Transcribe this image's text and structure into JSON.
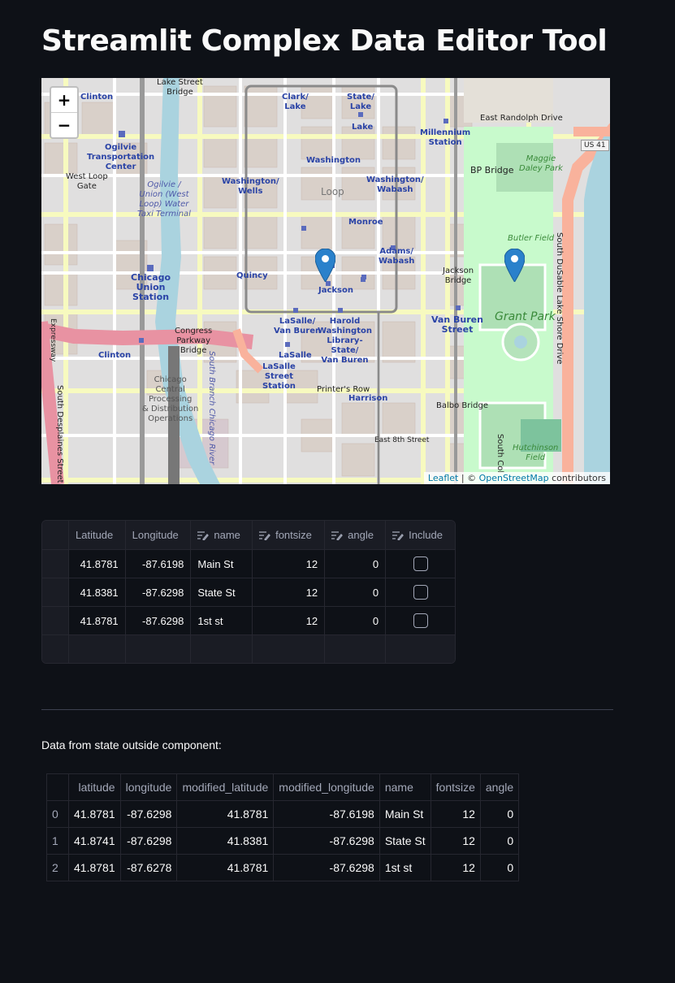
{
  "page": {
    "title": "Streamlit Complex Data Editor Tool"
  },
  "map": {
    "zoom_in": "+",
    "zoom_out": "−",
    "labels": {
      "clinton_top": "Clinton",
      "lake_street_bridge": "Lake Street\nBridge",
      "clark_lake": "Clark/\nLake",
      "state_lake": "State/\nLake",
      "lake": "Lake",
      "east_randolph": "East Randolph Drive",
      "millennium": "Millennium\nStation",
      "us41": "US 41",
      "ogilvie": "Ogilvie\nTransportation\nCenter",
      "west_loop_gate": "West Loop\nGate",
      "ogilvie_taxi": "Ogilvie /\nUnion (West\nLoop) Water\nTaxi Terminal",
      "washington": "Washington",
      "washington_wells": "Washington/\nWells",
      "loop": "Loop",
      "washington_wabash": "Washington/\nWabash",
      "bp_bridge": "BP Bridge",
      "maggie_daley": "Maggie\nDaley Park",
      "monroe": "Monroe",
      "butler_field": "Butler Field",
      "south_dusable": "South DuSable Lake Shore Drive",
      "chicago_union": "Chicago\nUnion\nStation",
      "quincy": "Quincy",
      "jackson": "Jackson",
      "adams_wabash": "Adams/\nWabash",
      "jackson_bridge": "Jackson\nBridge",
      "grant_park": "Grant Park",
      "congress_parkway": "Congress\nParkway\nBridge",
      "lasalle_van_buren": "LaSalle/\nVan Buren",
      "harold_washington": "Harold\nWashington\nLibrary-\nState/\nVan Buren",
      "van_buren_street": "Van Buren\nStreet",
      "clinton_bottom": "Clinton",
      "lasalle": "LaSalle",
      "lasalle_street": "LaSalle\nStreet\nStation",
      "chicago_central": "Chicago\nCentral\nProcessing\n& Distribution\nOperations",
      "south_branch": "South Branch Chicago River",
      "printers_row": "Printer's Row",
      "harrison": "Harrison",
      "balbo_bridge": "Balbo Bridge",
      "east_8th": "East 8th Street",
      "south_desplaines": "South Desplaines Street",
      "south_col": "South Col",
      "hutchinson": "Hutchinson\nField",
      "expressway": "Expressway"
    },
    "attribution": {
      "leaflet": "Leaflet",
      "sep": " | © ",
      "osm": "OpenStreetMap",
      "suffix": " contributors"
    },
    "markers": [
      {
        "label": "Jackson marker",
        "lat": 41.8781,
        "lng": -87.6298
      },
      {
        "label": "Grant Park marker",
        "lat": 41.8781,
        "lng": -87.6198
      }
    ]
  },
  "editor": {
    "columns": [
      "Latitude",
      "Longitude",
      "name",
      "fontsize",
      "angle",
      "Include"
    ],
    "rows": [
      {
        "lat": "41.8781",
        "lng": "-87.6198",
        "name": "Main St",
        "fontsize": "12",
        "angle": "0",
        "include": false
      },
      {
        "lat": "41.8381",
        "lng": "-87.6298",
        "name": "State St",
        "fontsize": "12",
        "angle": "0",
        "include": false
      },
      {
        "lat": "41.8781",
        "lng": "-87.6298",
        "name": "1st st",
        "fontsize": "12",
        "angle": "0",
        "include": false
      }
    ]
  },
  "state_caption": "Data from state outside component:",
  "state_table": {
    "columns": [
      "",
      "latitude",
      "longitude",
      "modified_latitude",
      "modified_longitude",
      "name",
      "fontsize",
      "angle"
    ],
    "rows": [
      [
        "0",
        "41.8781",
        "-87.6298",
        "41.8781",
        "-87.6198",
        "Main St",
        "12",
        "0"
      ],
      [
        "1",
        "41.8741",
        "-87.6298",
        "41.8381",
        "-87.6298",
        "State St",
        "12",
        "0"
      ],
      [
        "2",
        "41.8781",
        "-87.6278",
        "41.8781",
        "-87.6298",
        "1st st",
        "12",
        "0"
      ]
    ]
  }
}
